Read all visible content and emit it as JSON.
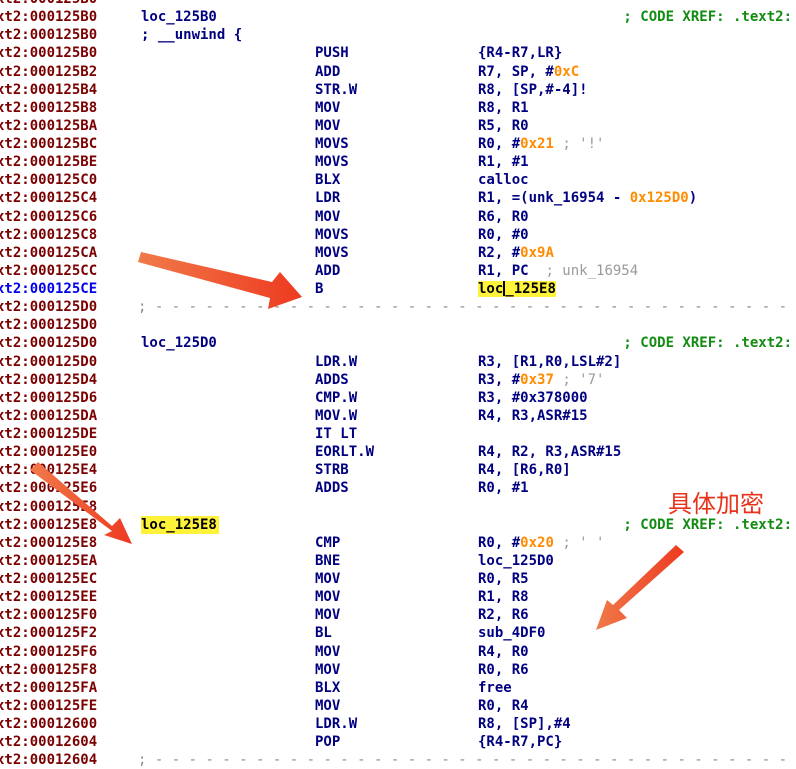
{
  "lines": [
    {
      "addr": "xt2:000125B0",
      "label": "",
      "mnem": "",
      "ops": "",
      "xref": "",
      "dash": false
    },
    {
      "addr": "xt2:000125B0",
      "label": "loc_125B0",
      "mnem": "",
      "ops": "",
      "xref": "; CODE XREF: .text2:",
      "dash": false
    },
    {
      "addr": "xt2:000125B0",
      "label": "; __unwind {",
      "mnem": "",
      "ops": "",
      "xref": "",
      "dash": false
    },
    {
      "addr": "xt2:000125B0",
      "label": "",
      "mnem": "PUSH",
      "ops": "{R4-R7,LR}",
      "xref": "",
      "dash": false
    },
    {
      "addr": "xt2:000125B2",
      "label": "",
      "mnem": "ADD",
      "ops": "R7, SP, #<n>0xC</n>",
      "xref": "",
      "dash": false
    },
    {
      "addr": "xt2:000125B4",
      "label": "",
      "mnem": "STR.W",
      "ops": "R8, [SP,#-4]!",
      "xref": "",
      "dash": false
    },
    {
      "addr": "xt2:000125B8",
      "label": "",
      "mnem": "MOV",
      "ops": "R8, R1",
      "xref": "",
      "dash": false
    },
    {
      "addr": "xt2:000125BA",
      "label": "",
      "mnem": "MOV",
      "ops": "R5, R0",
      "xref": "",
      "dash": false
    },
    {
      "addr": "xt2:000125BC",
      "label": "",
      "mnem": "MOVS",
      "ops": "R0, #<n>0x21</n> <c>; '!'</c>",
      "xref": "",
      "dash": false
    },
    {
      "addr": "xt2:000125BE",
      "label": "",
      "mnem": "MOVS",
      "ops": "R1, #1",
      "xref": "",
      "dash": false
    },
    {
      "addr": "xt2:000125C0",
      "label": "",
      "mnem": "BLX",
      "ops": "calloc",
      "xref": "",
      "dash": false
    },
    {
      "addr": "xt2:000125C4",
      "label": "",
      "mnem": "LDR",
      "ops": "R1, =(unk_16954 - <n>0x125D0</n>)",
      "xref": "",
      "dash": false
    },
    {
      "addr": "xt2:000125C6",
      "label": "",
      "mnem": "MOV",
      "ops": "R6, R0",
      "xref": "",
      "dash": false
    },
    {
      "addr": "xt2:000125C8",
      "label": "",
      "mnem": "MOVS",
      "ops": "R0, #0",
      "xref": "",
      "dash": false
    },
    {
      "addr": "xt2:000125CA",
      "label": "",
      "mnem": "MOVS",
      "ops": "R2, #<n>0x9A</n>",
      "xref": "",
      "dash": false
    },
    {
      "addr": "xt2:000125CC",
      "label": "",
      "mnem": "ADD",
      "ops": "R1, PC  <c>; unk_16954</c>",
      "xref": "",
      "dash": false
    },
    {
      "addr": "xt2:000125CE",
      "label": "",
      "mnem": "B",
      "ops": "<h>loc<k></k>_125E8</h>",
      "xref": "",
      "dash": false,
      "current": true
    },
    {
      "addr": "xt2:000125D0",
      "label": "",
      "mnem": "",
      "ops": "",
      "xref": "",
      "dash": true
    },
    {
      "addr": "xt2:000125D0",
      "label": "",
      "mnem": "",
      "ops": "",
      "xref": "",
      "dash": false
    },
    {
      "addr": "xt2:000125D0",
      "label": "loc_125D0",
      "mnem": "",
      "ops": "",
      "xref": "; CODE XREF: .text2:",
      "dash": false
    },
    {
      "addr": "xt2:000125D0",
      "label": "",
      "mnem": "LDR.W",
      "ops": "R3, [R1,R0,LSL#2]",
      "xref": "",
      "dash": false
    },
    {
      "addr": "xt2:000125D4",
      "label": "",
      "mnem": "ADDS",
      "ops": "R3, #<n>0x37</n> <c>; '7'</c>",
      "xref": "",
      "dash": false
    },
    {
      "addr": "xt2:000125D6",
      "label": "",
      "mnem": "CMP.W",
      "ops": "R3, #0x378000",
      "xref": "",
      "dash": false
    },
    {
      "addr": "xt2:000125DA",
      "label": "",
      "mnem": "MOV.W",
      "ops": "R4, R3,ASR#15",
      "xref": "",
      "dash": false
    },
    {
      "addr": "xt2:000125DE",
      "label": "",
      "mnem": "IT LT",
      "ops": "",
      "xref": "",
      "dash": false
    },
    {
      "addr": "xt2:000125E0",
      "label": "",
      "mnem": "EORLT.W",
      "ops": "R4, R2, R3,ASR#15",
      "xref": "",
      "dash": false
    },
    {
      "addr": "xt2:000125E4",
      "label": "",
      "mnem": "STRB",
      "ops": "R4, [R6,R0]",
      "xref": "",
      "dash": false
    },
    {
      "addr": "xt2:000125E6",
      "label": "",
      "mnem": "ADDS",
      "ops": "R0, #1",
      "xref": "",
      "dash": false
    },
    {
      "addr": "xt2:000125E8",
      "label": "",
      "mnem": "",
      "ops": "",
      "xref": "",
      "dash": false
    },
    {
      "addr": "xt2:000125E8",
      "label": "loc_125E8",
      "mnem": "",
      "ops": "",
      "xref": "; CODE XREF: .text2:",
      "dash": false,
      "labelHighlight": true
    },
    {
      "addr": "xt2:000125E8",
      "label": "",
      "mnem": "CMP",
      "ops": "R0, #<n>0x20</n> <c>; ' '</c>",
      "xref": "",
      "dash": false
    },
    {
      "addr": "xt2:000125EA",
      "label": "",
      "mnem": "BNE",
      "ops": "loc_125D0",
      "xref": "",
      "dash": false
    },
    {
      "addr": "xt2:000125EC",
      "label": "",
      "mnem": "MOV",
      "ops": "R0, R5",
      "xref": "",
      "dash": false
    },
    {
      "addr": "xt2:000125EE",
      "label": "",
      "mnem": "MOV",
      "ops": "R1, R8",
      "xref": "",
      "dash": false
    },
    {
      "addr": "xt2:000125F0",
      "label": "",
      "mnem": "MOV",
      "ops": "R2, R6",
      "xref": "",
      "dash": false
    },
    {
      "addr": "xt2:000125F2",
      "label": "",
      "mnem": "BL",
      "ops": "sub_4DF0",
      "xref": "",
      "dash": false
    },
    {
      "addr": "xt2:000125F6",
      "label": "",
      "mnem": "MOV",
      "ops": "R4, R0",
      "xref": "",
      "dash": false
    },
    {
      "addr": "xt2:000125F8",
      "label": "",
      "mnem": "MOV",
      "ops": "R0, R6",
      "xref": "",
      "dash": false
    },
    {
      "addr": "xt2:000125FA",
      "label": "",
      "mnem": "BLX",
      "ops": "free",
      "xref": "",
      "dash": false
    },
    {
      "addr": "xt2:000125FE",
      "label": "",
      "mnem": "MOV",
      "ops": "R0, R4",
      "xref": "",
      "dash": false
    },
    {
      "addr": "xt2:00012600",
      "label": "",
      "mnem": "LDR.W",
      "ops": "R8, [SP],#4",
      "xref": "",
      "dash": false
    },
    {
      "addr": "xt2:00012604",
      "label": "",
      "mnem": "POP",
      "ops": "{R4-R7,PC}",
      "xref": "",
      "dash": false
    },
    {
      "addr": "xt2:00012604",
      "label": "",
      "mnem": "",
      "ops": "",
      "xref": "",
      "dash": true
    }
  ],
  "annotation": "具体加密",
  "colors": {
    "address": "#7b0000",
    "current_address": "#0000ee",
    "code": "#000080",
    "immediate": "#ff8c00",
    "comment": "#9a9a9a",
    "xref": "#128c12",
    "highlight": "#fff23a",
    "arrow": "#f04a2a"
  }
}
